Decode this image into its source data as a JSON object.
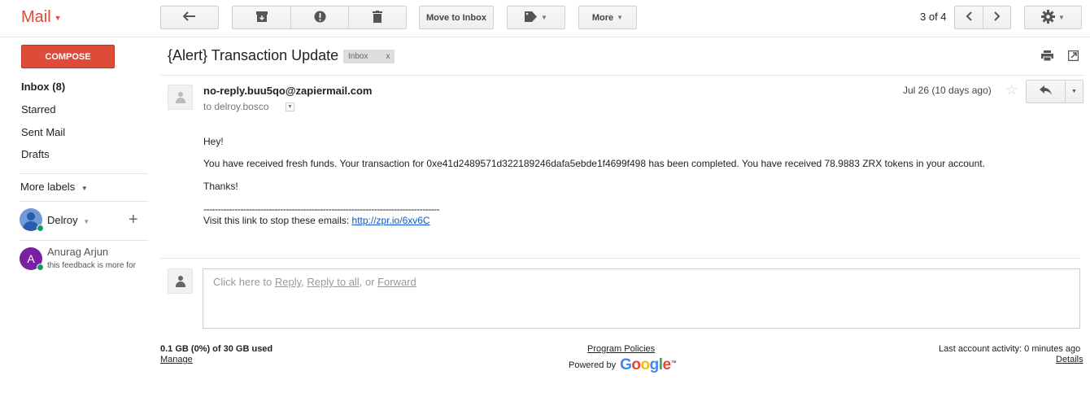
{
  "header": {
    "app_title": "Mail",
    "move_to_inbox": "Move to Inbox",
    "more": "More",
    "pager": "3 of 4",
    "icons": [
      "back-arrow-icon",
      "archive-icon",
      "report-spam-icon",
      "delete-icon",
      "label-icon",
      "chevron-left-icon",
      "chevron-right-icon",
      "gear-icon"
    ]
  },
  "sidebar": {
    "compose": "COMPOSE",
    "items": [
      {
        "label": "Inbox (8)"
      },
      {
        "label": "Starred"
      },
      {
        "label": "Sent Mail"
      },
      {
        "label": "Drafts"
      }
    ],
    "more_labels": "More labels",
    "chat_user": "Delroy",
    "contacts": [
      {
        "name": "Anurag Arjun",
        "initial": "A",
        "status": "this feedback is more for"
      }
    ]
  },
  "thread": {
    "subject": "{Alert} Transaction Update",
    "label": "Inbox",
    "label_remove": "x"
  },
  "message": {
    "sender": "no-reply.buu5qo@zapiermail.com",
    "to": "to delroy.bosco",
    "date": "Jul 26 (10 days ago)",
    "greeting": "Hey!",
    "body": "You have received fresh funds. Your transaction for 0xe41d2489571d322189246dafa5ebde1f4699f498 has been completed. You have received 78.9883 ZRX tokens in your account.",
    "thanks": "Thanks!",
    "divider": "-----------------------------------------------------------------------------------",
    "unsubscribe_text": "Visit this link to stop these emails: ",
    "unsubscribe_link": "http://zpr.io/6xv6C"
  },
  "reply": {
    "prefix": "Click here to ",
    "reply": "Reply",
    "sep1": ", ",
    "reply_all": "Reply to all",
    "sep2": ", or ",
    "forward": "Forward"
  },
  "footer": {
    "storage": "0.1 GB (0%) of 30 GB used",
    "manage": "Manage",
    "policies": "Program Policies",
    "powered_by": "Powered by",
    "google": "Google",
    "last_activity": "Last account activity: 0 minutes ago",
    "details": "Details"
  },
  "colors": {
    "brand_red": "#dd4b39",
    "link_blue": "#1155cc",
    "online_green": "#0f9d58"
  }
}
